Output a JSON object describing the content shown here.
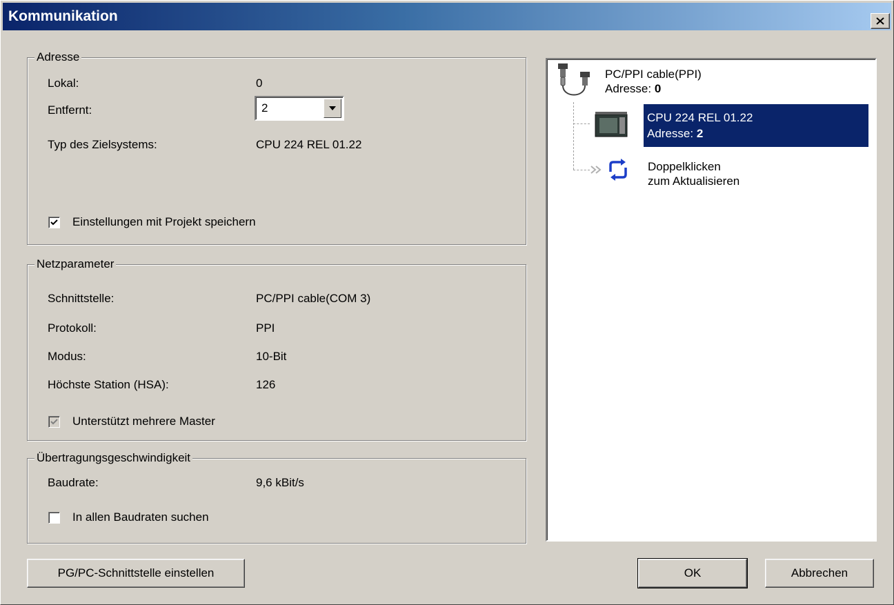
{
  "window": {
    "title": "Kommunikation",
    "close_label": "×"
  },
  "adresse": {
    "legend": "Adresse",
    "lokal_label": "Lokal:",
    "lokal_value": "0",
    "entfernt_label": "Entfernt:",
    "entfernt_value": "2",
    "zieltyp_label": "Typ des Zielsystems:",
    "zieltyp_value": "CPU 224 REL 01.22",
    "save_checkbox_label": "Einstellungen mit Projekt speichern",
    "save_checked": true
  },
  "netz": {
    "legend": "Netzparameter",
    "rows": [
      {
        "label": "Schnittstelle:",
        "value": "PC/PPI cable(COM 3)"
      },
      {
        "label": "Protokoll:",
        "value": "PPI"
      },
      {
        "label": "Modus:",
        "value": "10-Bit"
      },
      {
        "label": "Höchste Station (HSA):",
        "value": "126"
      }
    ],
    "multimaster_label": "Unterstützt mehrere Master",
    "multimaster_checked": true,
    "multimaster_disabled": true
  },
  "speed": {
    "legend": "Übertragungsgeschwindigkeit",
    "baud_label": "Baudrate:",
    "baud_value": "9,6 kBit/s",
    "search_label": "In allen Baudraten suchen",
    "search_checked": false
  },
  "tree": {
    "cable_name": "PC/PPI cable(PPI)",
    "cable_addr_label": "Adresse:",
    "cable_addr_value": "0",
    "cpu_name": "CPU 224 REL 01.22",
    "cpu_addr_label": "Adresse:",
    "cpu_addr_value": "2",
    "refresh_line1": "Doppelklicken",
    "refresh_line2": "zum Aktualisieren"
  },
  "buttons": {
    "pgpc": "PG/PC-Schnittstelle einstellen",
    "ok": "OK",
    "cancel": "Abbrechen"
  },
  "colors": {
    "title_start": "#0a246a",
    "title_end": "#a6caf0",
    "selection": "#0a246a",
    "face": "#d4d0c8"
  }
}
